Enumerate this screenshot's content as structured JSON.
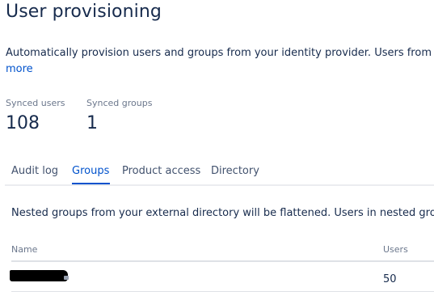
{
  "header": {
    "title": "User provisioning"
  },
  "intro": {
    "description": "Automatically provision users and groups from your identity provider. Users from verif",
    "more_link": "more"
  },
  "stats": {
    "synced_users_label": "Synced users",
    "synced_users_value": "108",
    "synced_groups_label": "Synced groups",
    "synced_groups_value": "1"
  },
  "tabs": [
    {
      "label": "Audit log",
      "active": false
    },
    {
      "label": "Groups",
      "active": true
    },
    {
      "label": "Product access",
      "active": false
    },
    {
      "label": "Directory",
      "active": false
    }
  ],
  "groups_panel": {
    "note": "Nested groups from your external directory will be flattened. Users in nested groups",
    "columns": {
      "name": "Name",
      "users": "Users"
    },
    "rows": [
      {
        "name": "",
        "users": "50",
        "name_redacted": true
      }
    ]
  },
  "colors": {
    "accent": "#0052cc",
    "text": "#172b4d",
    "subtle_text": "#6b778c",
    "border": "#dfe1e6"
  },
  "icons": [
    "lock-icon"
  ]
}
